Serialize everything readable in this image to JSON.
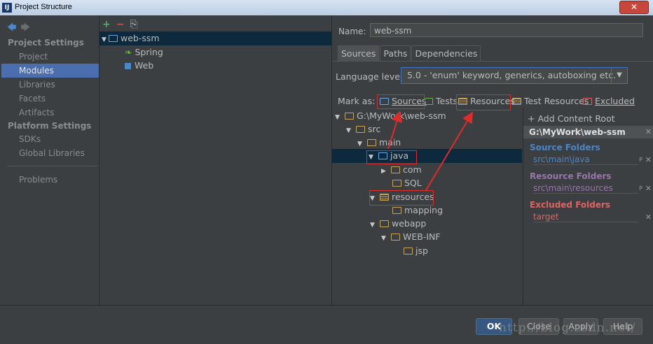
{
  "window": {
    "title": "Project Structure",
    "close_label": "✕"
  },
  "sidebar": {
    "project_settings": "Project Settings",
    "items_ps": [
      "Project",
      "Modules",
      "Libraries",
      "Facets",
      "Artifacts"
    ],
    "platform_settings": "Platform Settings",
    "items_plat": [
      "SDKs",
      "Global Libraries"
    ],
    "problems": "Problems"
  },
  "modules": {
    "toolbar": {
      "add": "+",
      "remove": "−",
      "copy": "⎘"
    },
    "root": "web-ssm",
    "children": [
      "Spring",
      "Web"
    ]
  },
  "details": {
    "name_label": "Name:",
    "name_value": "web-ssm",
    "tabs": [
      "Sources",
      "Paths",
      "Dependencies"
    ],
    "language_label": "Language level:",
    "language_value": "5.0 - 'enum' keyword, generics, autoboxing etc.",
    "mark_as": "Mark as:",
    "mark_options": [
      "Sources",
      "Tests",
      "Resources",
      "Test Resources",
      "Excluded"
    ],
    "tree": [
      {
        "label": "G:\\MyWork\\web-ssm"
      },
      {
        "label": "src"
      },
      {
        "label": "main"
      },
      {
        "label": "java"
      },
      {
        "label": "com"
      },
      {
        "label": "SQL"
      },
      {
        "label": "resources"
      },
      {
        "label": "mapping"
      },
      {
        "label": "webapp"
      },
      {
        "label": "WEB-INF"
      },
      {
        "label": "jsp"
      }
    ]
  },
  "content_root": {
    "add_label": "Add Content Root",
    "root_path": "G:\\MyWork\\web-ssm",
    "source_title": "Source Folders",
    "source_item": "src\\main\\java",
    "resource_title": "Resource Folders",
    "resource_item": "src\\main\\resources",
    "excluded_title": "Excluded Folders",
    "excluded_item": "target",
    "colors": {
      "source": "#4a86c8",
      "resource": "#9876aa",
      "excluded": "#e06363"
    }
  },
  "buttons": {
    "ok": "OK",
    "close": "Close",
    "apply": "Apply",
    "help": "Help"
  },
  "watermark": "http://blog.csdn.net/"
}
